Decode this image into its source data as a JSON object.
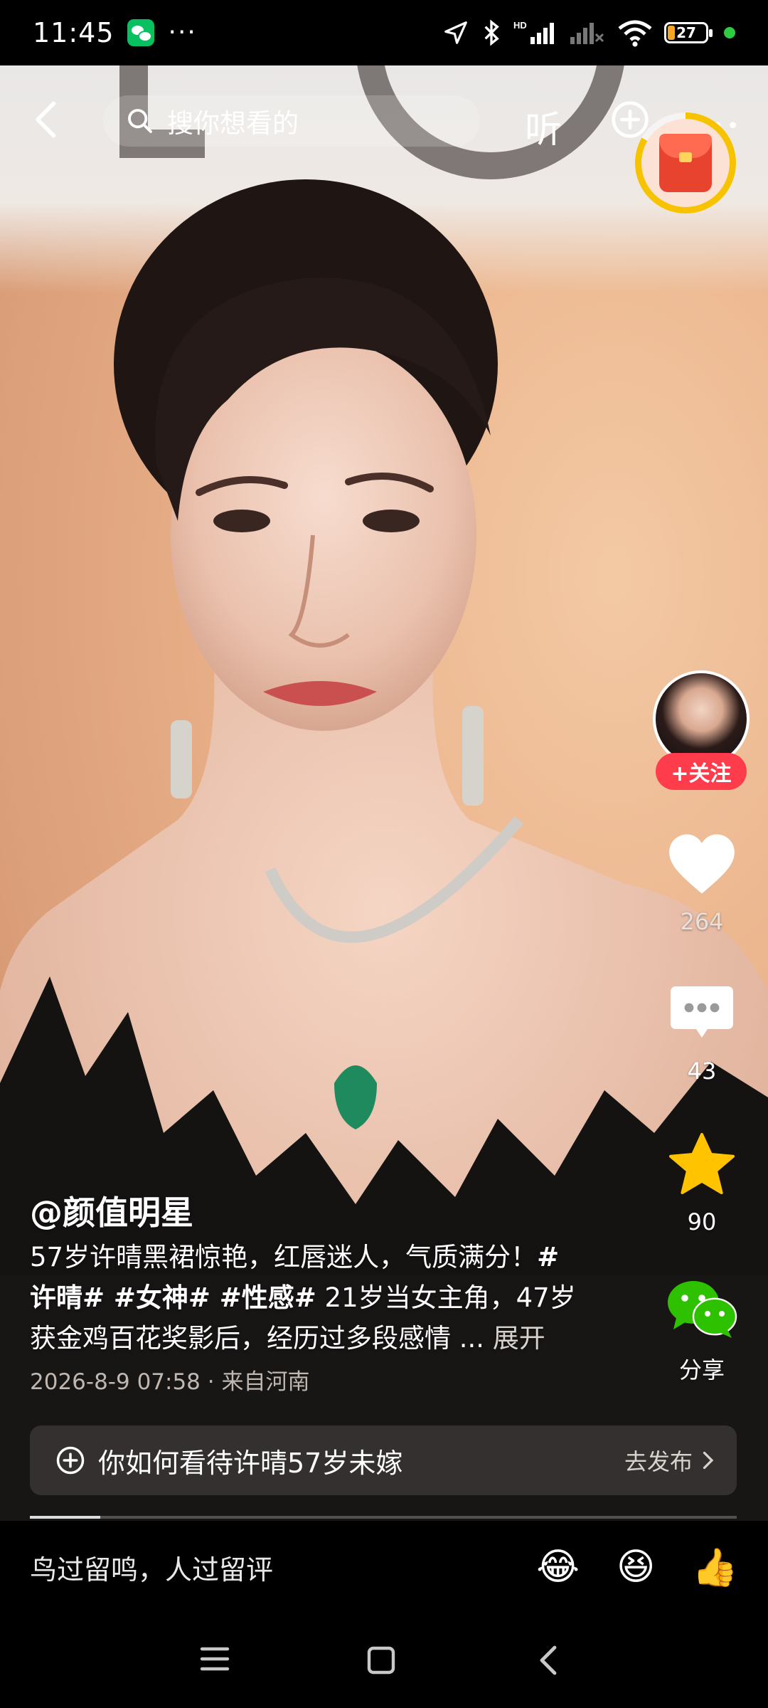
{
  "status_bar": {
    "time": "11:45",
    "more": "···",
    "battery": "27",
    "network_label": "HD"
  },
  "top_nav": {
    "search_placeholder": "搜你想看的",
    "listen_label": "听"
  },
  "side_rail": {
    "follow_label": "+关注",
    "like_count": "264",
    "comment_count": "43",
    "favorite_count": "90",
    "share_label": "分享"
  },
  "post": {
    "author": "@颜值明星",
    "caption_line1_text": "57岁许晴黑裙惊艳，红唇迷人，气质满分！",
    "caption_line1_tag": "#",
    "caption_line2_tags": "许晴# #女神# #性感#",
    "caption_line2_text": " 21岁当女主角，47岁",
    "caption_line3_text": "获金鸡百花奖影后，经历过多段感情 ... ",
    "expand_label": "展开",
    "date": "2026-8-9 07:58",
    "location": "来自河南",
    "meta_sep": " · "
  },
  "topic": {
    "text": "你如何看待许晴57岁未嫁",
    "action": "去发布"
  },
  "video_progress": 0.1,
  "comment_bar": {
    "placeholder": "鸟过留鸣，人过留评",
    "emojis": [
      "😂",
      "😆",
      "👍"
    ]
  },
  "colors": {
    "follow_red": "#fe3c4c",
    "favorite_yellow": "#ffc300",
    "wechat_green": "#07c160",
    "redpack_ring": "#f7c300"
  }
}
